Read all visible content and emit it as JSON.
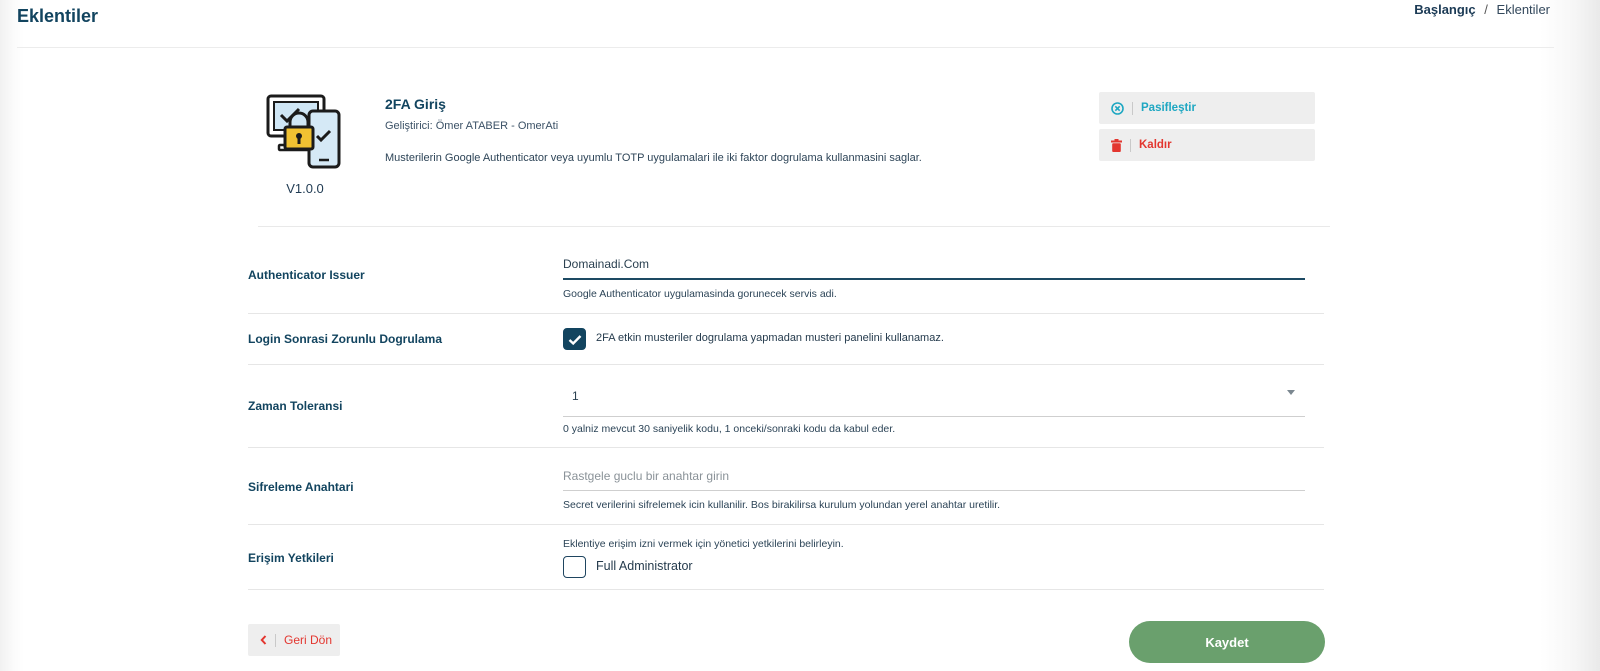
{
  "page": {
    "title": "Eklentiler"
  },
  "breadcrumb": {
    "home": "Başlangıç",
    "separator": "/",
    "current": "Eklentiler"
  },
  "plugin": {
    "icon": "2fa-devices-lock-icon",
    "version": "V1.0.0",
    "name": "2FA Giriş",
    "developer": "Geliştirici: Ömer ATABER - OmerAti",
    "description": "Musterilerin Google Authenticator veya uyumlu TOTP uygulamalari ile iki faktor dogrulama kullanmasini saglar."
  },
  "actions": {
    "deactivate_label": "Pasifleştir",
    "deactivate_icon": "circle-x-icon",
    "deactivate_color": "#1ea7c2",
    "remove_label": "Kaldır",
    "remove_icon": "trash-icon",
    "remove_color": "#e3362f"
  },
  "settings": {
    "issuer": {
      "label": "Authenticator Issuer",
      "value": "Domainadi.Com",
      "help": "Google Authenticator uygulamasinda gorunecek servis adi."
    },
    "forced_verification": {
      "label": "Login Sonrasi Zorunlu Dogrulama",
      "checked": true,
      "text": "2FA etkin musteriler dogrulama yapmadan musteri panelini kullanamaz."
    },
    "time_tolerance": {
      "label": "Zaman Toleransi",
      "value": "1",
      "help": "0 yalniz mevcut 30 saniyelik kodu, 1 onceki/sonraki kodu da kabul eder."
    },
    "encryption_key": {
      "label": "Sifreleme Anahtari",
      "placeholder": "Rastgele guclu bir anahtar girin",
      "help": "Secret verilerini sifrelemek icin kullanilir. Bos birakilirsa kurulum yolundan yerel anahtar uretilir."
    },
    "access": {
      "label": "Erişim Yetkileri",
      "help": "Eklentiye erişim izni vermek için yönetici yetkilerini belirleyin.",
      "option_label": "Full Administrator",
      "option_checked": false
    }
  },
  "footer": {
    "back_label": "Geri Dön",
    "save_label": "Kaydet",
    "save_color": "#6aa06d"
  }
}
